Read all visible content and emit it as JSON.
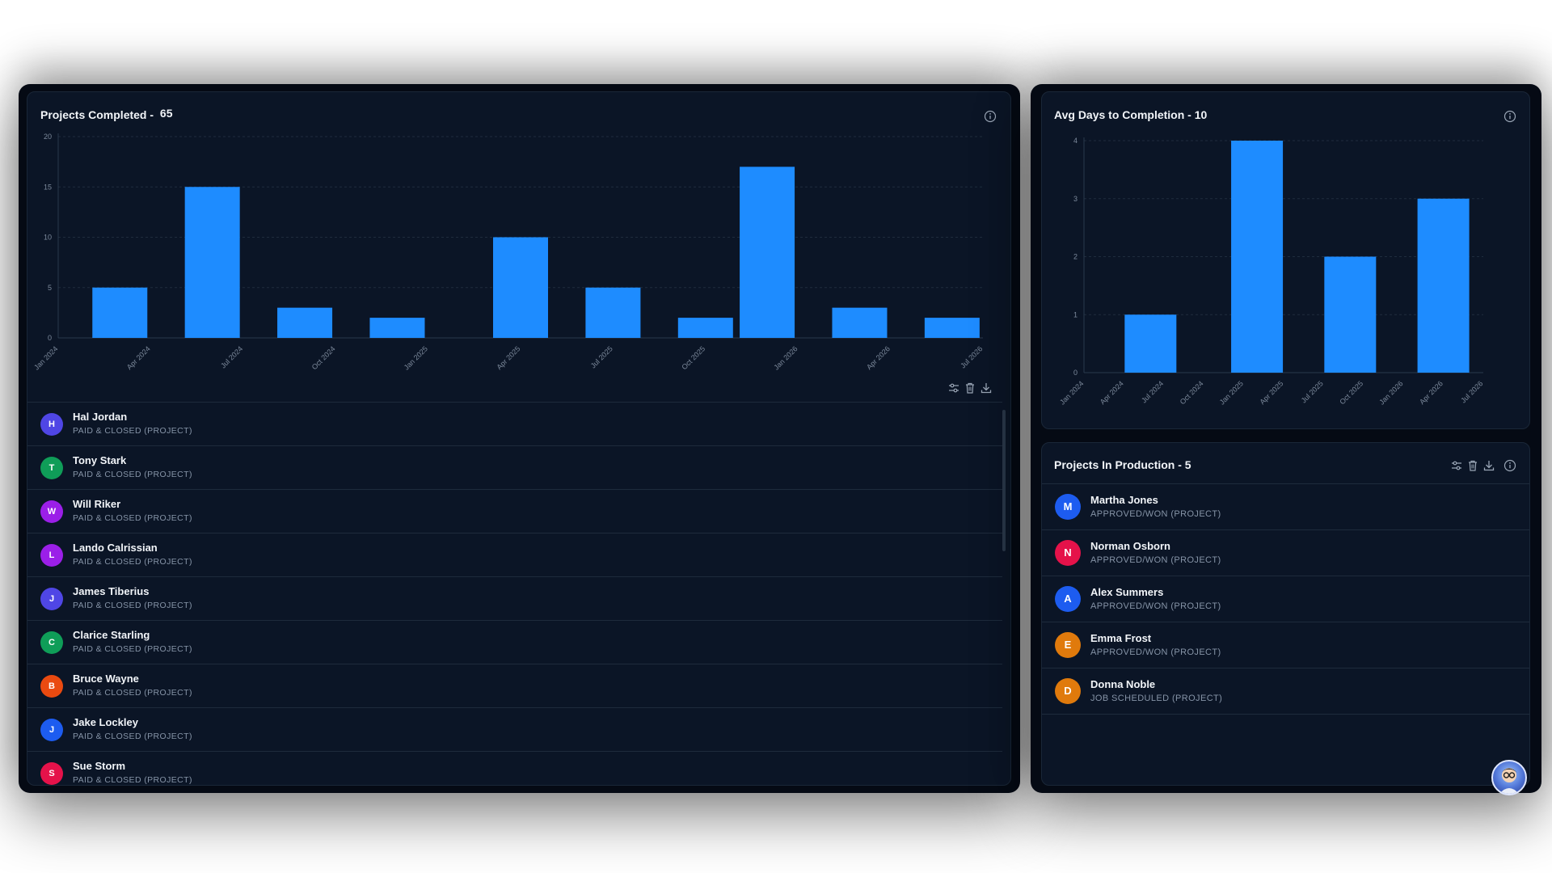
{
  "colors": {
    "bar": "#1e8cff",
    "panel_bg": "#050a14",
    "card_bg": "#0b1526",
    "grid": "#1f2c3d",
    "axis_text": "#7d8a9c"
  },
  "projects_completed": {
    "title": "Projects Completed -",
    "count": "65"
  },
  "avg_days": {
    "title": "Avg Days to Completion - 10"
  },
  "production": {
    "title": "Projects In Production - 5"
  },
  "icons": {
    "info": "info-icon",
    "filter": "filter-icon",
    "delete": "trash-icon",
    "download": "download-icon"
  },
  "chart_data": [
    {
      "type": "bar",
      "title": "Projects Completed - 65",
      "tick_labels_x": [
        "Jan 2024",
        "Apr 2024",
        "Jul 2024",
        "Oct 2024",
        "Jan 2025",
        "Apr 2025",
        "Jul 2025",
        "Oct 2025",
        "Jan 2026",
        "Apr 2026",
        "Jul 2026"
      ],
      "x_range": [
        "2024-01",
        "2026-07"
      ],
      "x": [
        "2024-03",
        "2024-06",
        "2024-09",
        "2024-12",
        "2025-04",
        "2025-07",
        "2025-10",
        "2025-12",
        "2026-03",
        "2026-06"
      ],
      "values": [
        5,
        15,
        3,
        2,
        10,
        5,
        2,
        17,
        3,
        2
      ],
      "ylim": [
        0,
        20
      ],
      "yticks": [
        0,
        5,
        10,
        15,
        20
      ],
      "grid": true
    },
    {
      "type": "bar",
      "title": "Avg Days to Completion - 10",
      "tick_labels_x": [
        "Jan 2024",
        "Apr 2024",
        "Jul 2024",
        "Oct 2024",
        "Jan 2025",
        "Apr 2025",
        "Jul 2025",
        "Oct 2025",
        "Jan 2026",
        "Apr 2026",
        "Jul 2026"
      ],
      "x_range": [
        "2024-01",
        "2026-07"
      ],
      "x": [
        "2024-06",
        "2025-02",
        "2025-09",
        "2026-04"
      ],
      "values": [
        1,
        4,
        2,
        3
      ],
      "ylim": [
        0,
        4
      ],
      "yticks": [
        0,
        1,
        2,
        3,
        4
      ],
      "grid": true
    }
  ],
  "completed_list": [
    {
      "initial": "H",
      "name": "Hal Jordan",
      "status": "PAID & CLOSED (PROJECT)",
      "color": "#4f46e5"
    },
    {
      "initial": "T",
      "name": "Tony Stark",
      "status": "PAID & CLOSED (PROJECT)",
      "color": "#0f9d58"
    },
    {
      "initial": "W",
      "name": "Will Riker",
      "status": "PAID & CLOSED (PROJECT)",
      "color": "#9b1fe8"
    },
    {
      "initial": "L",
      "name": "Lando Calrissian",
      "status": "PAID & CLOSED (PROJECT)",
      "color": "#9b1fe8"
    },
    {
      "initial": "J",
      "name": "James Tiberius",
      "status": "PAID & CLOSED (PROJECT)",
      "color": "#4f46e5"
    },
    {
      "initial": "C",
      "name": "Clarice Starling",
      "status": "PAID & CLOSED (PROJECT)",
      "color": "#0f9d58"
    },
    {
      "initial": "B",
      "name": "Bruce Wayne",
      "status": "PAID & CLOSED (PROJECT)",
      "color": "#ea4a10"
    },
    {
      "initial": "J",
      "name": "Jake Lockley",
      "status": "PAID & CLOSED (PROJECT)",
      "color": "#1d5cf0"
    },
    {
      "initial": "S",
      "name": "Sue Storm",
      "status": "PAID & CLOSED (PROJECT)",
      "color": "#e5124a"
    }
  ],
  "production_list": [
    {
      "initial": "M",
      "name": "Martha Jones",
      "status": "APPROVED/WON (PROJECT)",
      "color": "#1d5cf0"
    },
    {
      "initial": "N",
      "name": "Norman Osborn",
      "status": "APPROVED/WON (PROJECT)",
      "color": "#e5124a"
    },
    {
      "initial": "A",
      "name": "Alex Summers",
      "status": "APPROVED/WON (PROJECT)",
      "color": "#1d5cf0"
    },
    {
      "initial": "E",
      "name": "Emma Frost",
      "status": "APPROVED/WON (PROJECT)",
      "color": "#e07a0c"
    },
    {
      "initial": "D",
      "name": "Donna Noble",
      "status": "JOB SCHEDULED (PROJECT)",
      "color": "#e07a0c"
    }
  ]
}
